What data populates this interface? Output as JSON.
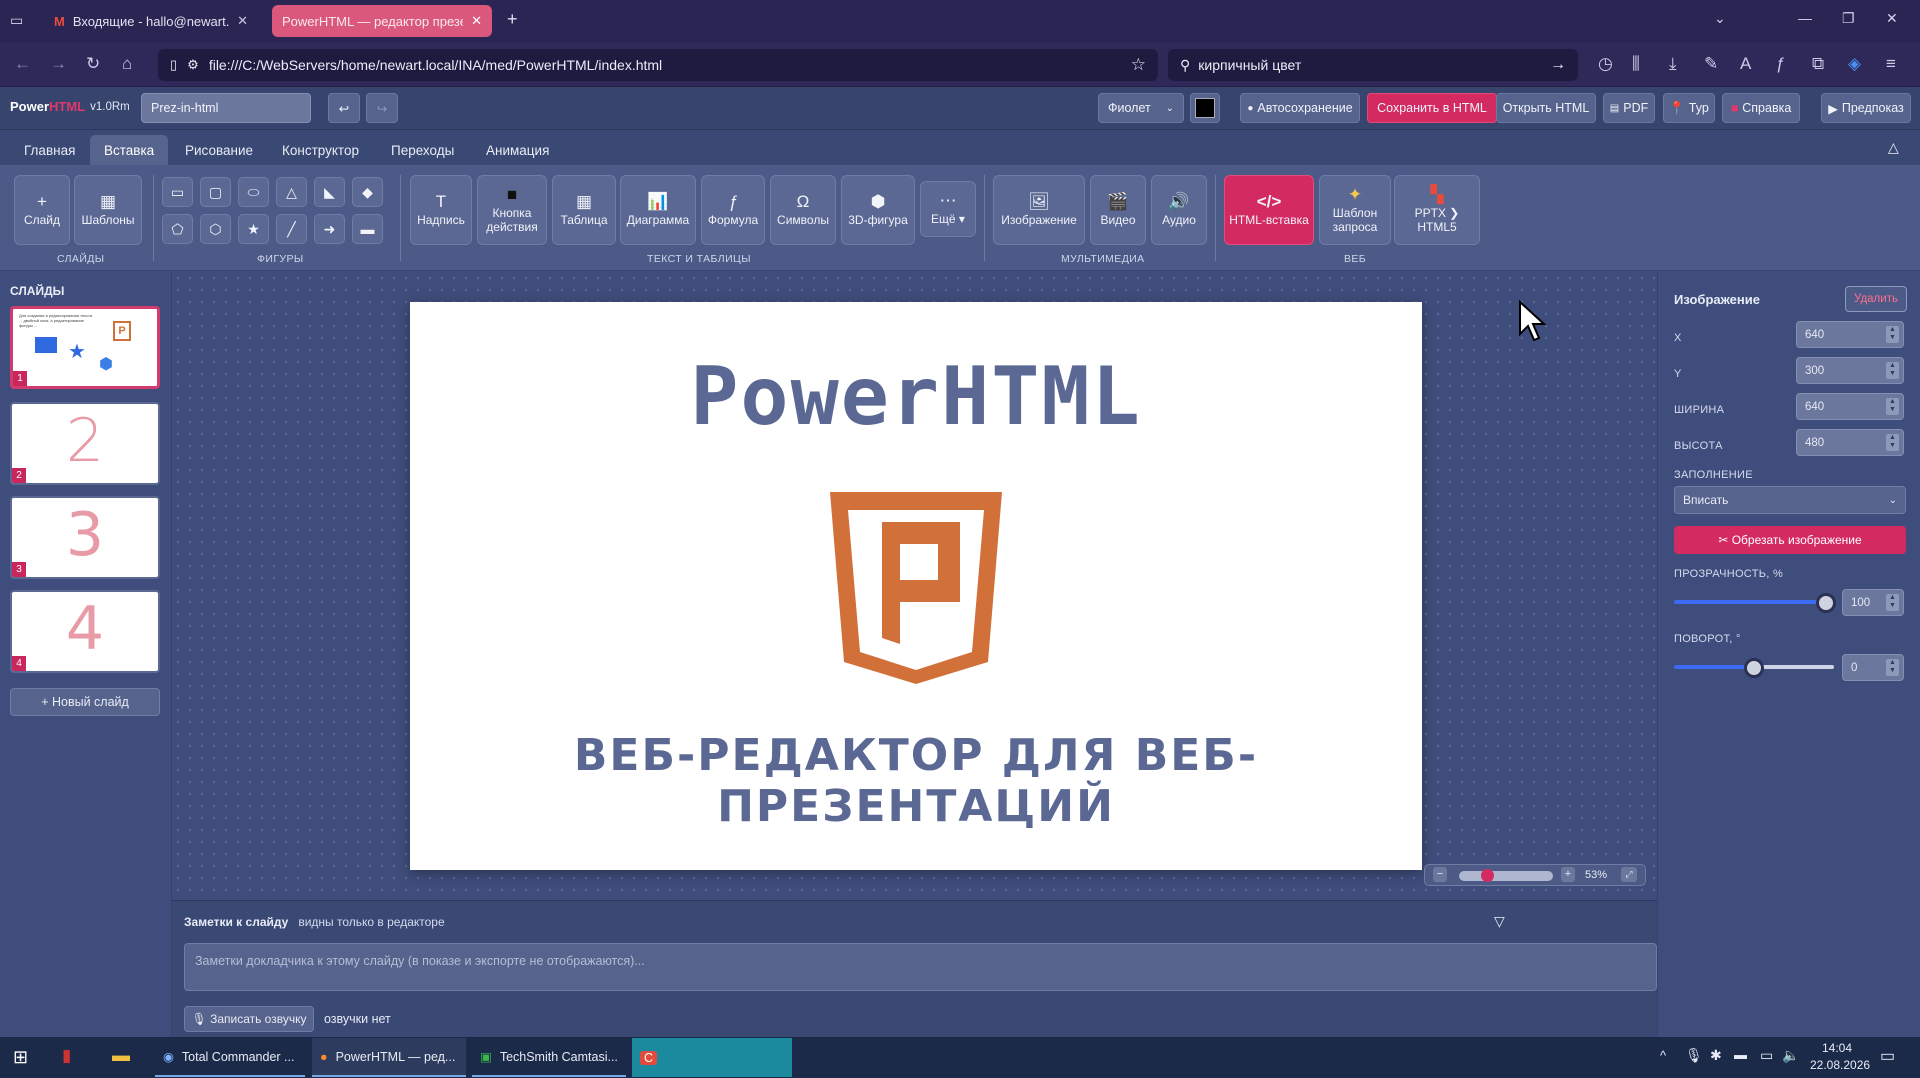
{
  "browser": {
    "tabs": [
      {
        "title": "Входящие - hallo@newart.ru -",
        "active": false
      },
      {
        "title": "PowerHTML — редактор презента",
        "active": true
      }
    ],
    "url": "file:///C:/WebServers/home/newart.local/INA/med/PowerHTML/index.html",
    "search_text": "кирпичный цвет"
  },
  "app": {
    "logo_power": "Power",
    "logo_html": "HTML",
    "version": "v1.0Rm",
    "doc_name": "Prez-in-html",
    "theme": "Фиолет",
    "autosave": "Автосохранение",
    "save_html": "Сохранить в HTML",
    "open_html": "Открыть HTML",
    "pdf": "PDF",
    "tour": "Тур",
    "help": "Справка",
    "preview": "Предпоказ",
    "accent_color": "#d42a62"
  },
  "ribbon_tabs": [
    "Главная",
    "Вставка",
    "Рисование",
    "Конструктор",
    "Переходы",
    "Анимация"
  ],
  "ribbon": {
    "slide": "Слайд",
    "templates": "Шаблоны",
    "group_slides": "СЛАЙДЫ",
    "group_shapes": "ФИГУРЫ",
    "group_text": "ТЕКСТ И ТАБЛИЦЫ",
    "group_media": "МУЛЬТИМЕДИА",
    "group_web": "ВЕБ",
    "textbox": "Надпись",
    "action_btn_1": "Кнопка",
    "action_btn_2": "действия",
    "table": "Таблица",
    "chart": "Диаграмма",
    "formula": "Формула",
    "symbols": "Символы",
    "shape3d": "3D-фигура",
    "more": "Ещё ▾",
    "image": "Изображение",
    "video": "Видео",
    "audio": "Аудио",
    "html_insert": "HTML-вставка",
    "query_tpl_1": "Шаблон",
    "query_tpl_2": "запроса",
    "pptx": "PPTX ❯ HTML5"
  },
  "sidebar": {
    "title": "СЛАЙДЫ",
    "slides": [
      {
        "num": "1",
        "mini_text": "Для создания и редактирования текста ... двойной клик, а редактирование фигуры ..."
      },
      {
        "num": "2",
        "big": "2"
      },
      {
        "num": "3",
        "big": "3"
      },
      {
        "num": "4",
        "big": "4"
      }
    ],
    "new_slide": "+ Новый слайд"
  },
  "slide": {
    "title": "PowerHTML",
    "subtitle": "ВЕБ-РЕДАКТОР ДЛЯ ВЕБ-ПРЕЗЕНТАЦИЙ",
    "logo_letter": "P"
  },
  "zoom": {
    "level": "53%",
    "fraction": 0.3
  },
  "notes": {
    "title": "Заметки к слайду",
    "hint": "видны только в редакторе",
    "placeholder": "Заметки докладчика к этому слайду (в показе и экспорте не отображаются)...",
    "record": "🎙 Записать озвучку",
    "voice_status": "озвучки нет"
  },
  "panel": {
    "title": "Изображение",
    "delete": "Удалить",
    "x_label": "X",
    "x": "640",
    "y_label": "Y",
    "y": "300",
    "w_label": "ШИРИНА",
    "w": "640",
    "h_label": "ВЫСОТА",
    "h": "480",
    "fill_label": "ЗАПОЛНЕНИЕ",
    "fill_value": "Вписать",
    "crop": "✂ Обрезать изображение",
    "opacity_label": "ПРОЗРАЧНОСТЬ, %",
    "opacity": "100",
    "opacity_fraction": 1.0,
    "rotation_label": "ПОВОРОТ, °",
    "rotation": "0",
    "rotation_fraction": 0.5
  },
  "taskbar": {
    "items": [
      "Total Commander ...",
      "PowerHTML — ред...",
      "TechSmith Camtasi..."
    ],
    "time": "14:04",
    "date": "22.08.2026"
  }
}
